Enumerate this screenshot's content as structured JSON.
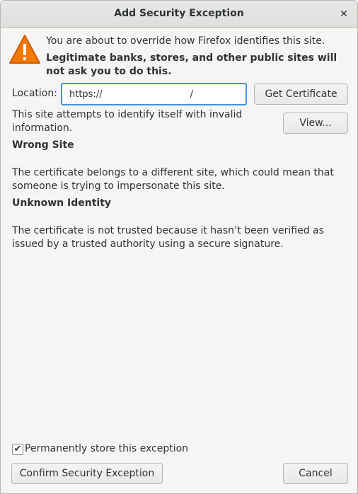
{
  "window": {
    "title": "Add Security Exception",
    "close_icon": "close-icon"
  },
  "warning": {
    "icon": "warning-triangle-icon",
    "line1": "You are about to override how Firefox identifies this site.",
    "line2": "Legitimate banks, stores, and other public sites will not ask you to do this."
  },
  "location": {
    "label": "Location:",
    "value": "https://                              /"
  },
  "buttons": {
    "get_certificate": "Get Certificate",
    "view": "View...",
    "confirm": "Confirm Security Exception",
    "cancel": "Cancel"
  },
  "status": {
    "summary": "This site attempts to identify itself with invalid information.",
    "wrong_site_heading": "Wrong Site",
    "wrong_site_text": "The certificate belongs to a different site, which could mean that someone is trying to impersonate this site.",
    "unknown_identity_heading": "Unknown Identity",
    "unknown_identity_text": "The certificate is not trusted because it hasn’t been verified as issued by a trusted authority using a secure signature."
  },
  "permanent": {
    "label": "Permanently store this exception",
    "checked": true
  },
  "colors": {
    "accent": "#4a90d9",
    "warning": "#f57900"
  }
}
